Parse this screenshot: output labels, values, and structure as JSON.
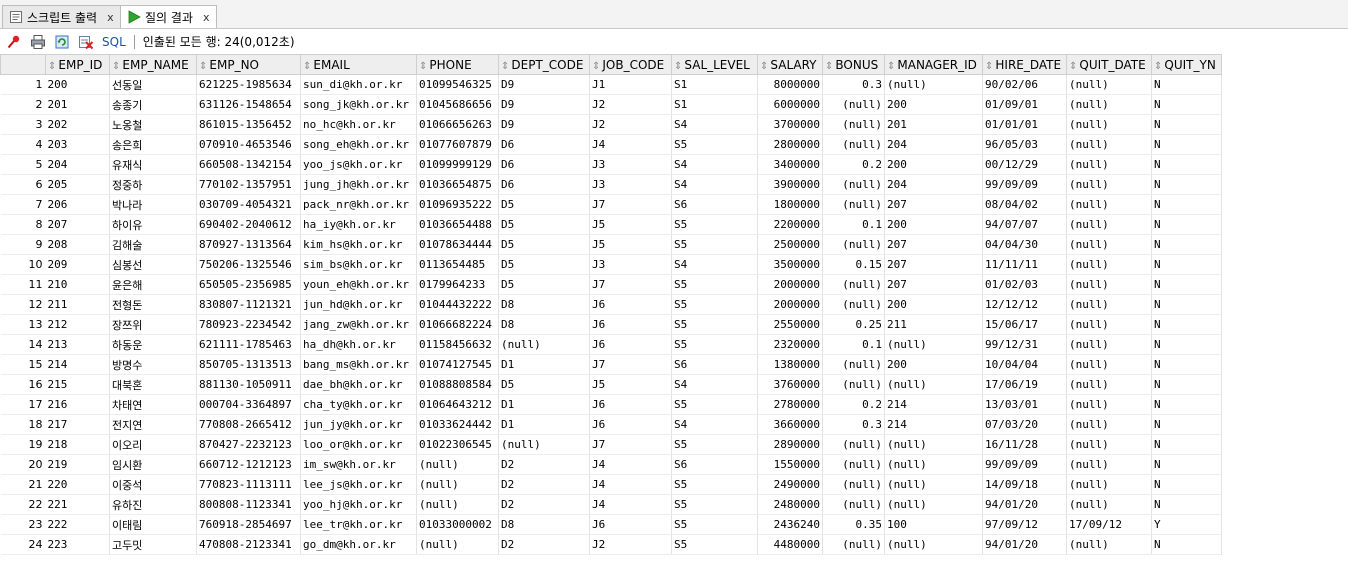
{
  "tabs": [
    {
      "label": "스크립트 출력",
      "close": "x",
      "icon": "script-output-icon"
    },
    {
      "label": "질의 결과",
      "close": "x",
      "icon": "run-icon"
    }
  ],
  "toolbar": {
    "sql_label": "SQL",
    "status": "인출된 모든 행: 24(0,012초)"
  },
  "columns": [
    "EMP_ID",
    "EMP_NAME",
    "EMP_NO",
    "EMAIL",
    "PHONE",
    "DEPT_CODE",
    "JOB_CODE",
    "SAL_LEVEL",
    "SALARY",
    "BONUS",
    "MANAGER_ID",
    "HIRE_DATE",
    "QUIT_DATE",
    "QUIT_YN"
  ],
  "rows": [
    [
      "1",
      "200",
      "선동일",
      "621225-1985634",
      "sun_di@kh.or.kr",
      "01099546325",
      "D9",
      "J1",
      "S1",
      "8000000",
      "0.3",
      "(null)",
      "90/02/06",
      "(null)",
      "N"
    ],
    [
      "2",
      "201",
      "송종기",
      "631126-1548654",
      "song_jk@kh.or.kr",
      "01045686656",
      "D9",
      "J2",
      "S1",
      "6000000",
      "(null)",
      "200",
      "01/09/01",
      "(null)",
      "N"
    ],
    [
      "3",
      "202",
      "노옹철",
      "861015-1356452",
      "no_hc@kh.or.kr",
      "01066656263",
      "D9",
      "J2",
      "S4",
      "3700000",
      "(null)",
      "201",
      "01/01/01",
      "(null)",
      "N"
    ],
    [
      "4",
      "203",
      "송은희",
      "070910-4653546",
      "song_eh@kh.or.kr",
      "01077607879",
      "D6",
      "J4",
      "S5",
      "2800000",
      "(null)",
      "204",
      "96/05/03",
      "(null)",
      "N"
    ],
    [
      "5",
      "204",
      "유재식",
      "660508-1342154",
      "yoo_js@kh.or.kr",
      "01099999129",
      "D6",
      "J3",
      "S4",
      "3400000",
      "0.2",
      "200",
      "00/12/29",
      "(null)",
      "N"
    ],
    [
      "6",
      "205",
      "정중하",
      "770102-1357951",
      "jung_jh@kh.or.kr",
      "01036654875",
      "D6",
      "J3",
      "S4",
      "3900000",
      "(null)",
      "204",
      "99/09/09",
      "(null)",
      "N"
    ],
    [
      "7",
      "206",
      "박나라",
      "030709-4054321",
      "pack_nr@kh.or.kr",
      "01096935222",
      "D5",
      "J7",
      "S6",
      "1800000",
      "(null)",
      "207",
      "08/04/02",
      "(null)",
      "N"
    ],
    [
      "8",
      "207",
      "하이유",
      "690402-2040612",
      "ha_iy@kh.or.kr",
      "01036654488",
      "D5",
      "J5",
      "S5",
      "2200000",
      "0.1",
      "200",
      "94/07/07",
      "(null)",
      "N"
    ],
    [
      "9",
      "208",
      "김해술",
      "870927-1313564",
      "kim_hs@kh.or.kr",
      "01078634444",
      "D5",
      "J5",
      "S5",
      "2500000",
      "(null)",
      "207",
      "04/04/30",
      "(null)",
      "N"
    ],
    [
      "10",
      "209",
      "심봉선",
      "750206-1325546",
      "sim_bs@kh.or.kr",
      "0113654485",
      "D5",
      "J3",
      "S4",
      "3500000",
      "0.15",
      "207",
      "11/11/11",
      "(null)",
      "N"
    ],
    [
      "11",
      "210",
      "윤은해",
      "650505-2356985",
      "youn_eh@kh.or.kr",
      "0179964233",
      "D5",
      "J7",
      "S5",
      "2000000",
      "(null)",
      "207",
      "01/02/03",
      "(null)",
      "N"
    ],
    [
      "12",
      "211",
      "전형돈",
      "830807-1121321",
      "jun_hd@kh.or.kr",
      "01044432222",
      "D8",
      "J6",
      "S5",
      "2000000",
      "(null)",
      "200",
      "12/12/12",
      "(null)",
      "N"
    ],
    [
      "13",
      "212",
      "장쯔위",
      "780923-2234542",
      "jang_zw@kh.or.kr",
      "01066682224",
      "D8",
      "J6",
      "S5",
      "2550000",
      "0.25",
      "211",
      "15/06/17",
      "(null)",
      "N"
    ],
    [
      "14",
      "213",
      "하동운",
      "621111-1785463",
      "ha_dh@kh.or.kr",
      "01158456632",
      "(null)",
      "J6",
      "S5",
      "2320000",
      "0.1",
      "(null)",
      "99/12/31",
      "(null)",
      "N"
    ],
    [
      "15",
      "214",
      "방명수",
      "850705-1313513",
      "bang_ms@kh.or.kr",
      "01074127545",
      "D1",
      "J7",
      "S6",
      "1380000",
      "(null)",
      "200",
      "10/04/04",
      "(null)",
      "N"
    ],
    [
      "16",
      "215",
      "대북혼",
      "881130-1050911",
      "dae_bh@kh.or.kr",
      "01088808584",
      "D5",
      "J5",
      "S4",
      "3760000",
      "(null)",
      "(null)",
      "17/06/19",
      "(null)",
      "N"
    ],
    [
      "17",
      "216",
      "차태연",
      "000704-3364897",
      "cha_ty@kh.or.kr",
      "01064643212",
      "D1",
      "J6",
      "S5",
      "2780000",
      "0.2",
      "214",
      "13/03/01",
      "(null)",
      "N"
    ],
    [
      "18",
      "217",
      "전지연",
      "770808-2665412",
      "jun_jy@kh.or.kr",
      "01033624442",
      "D1",
      "J6",
      "S4",
      "3660000",
      "0.3",
      "214",
      "07/03/20",
      "(null)",
      "N"
    ],
    [
      "19",
      "218",
      "이오리",
      "870427-2232123",
      "loo_or@kh.or.kr",
      "01022306545",
      "(null)",
      "J7",
      "S5",
      "2890000",
      "(null)",
      "(null)",
      "16/11/28",
      "(null)",
      "N"
    ],
    [
      "20",
      "219",
      "임시환",
      "660712-1212123",
      "im_sw@kh.or.kr",
      "(null)",
      "D2",
      "J4",
      "S6",
      "1550000",
      "(null)",
      "(null)",
      "99/09/09",
      "(null)",
      "N"
    ],
    [
      "21",
      "220",
      "이중석",
      "770823-1113111",
      "lee_js@kh.or.kr",
      "(null)",
      "D2",
      "J4",
      "S5",
      "2490000",
      "(null)",
      "(null)",
      "14/09/18",
      "(null)",
      "N"
    ],
    [
      "22",
      "221",
      "유하진",
      "800808-1123341",
      "yoo_hj@kh.or.kr",
      "(null)",
      "D2",
      "J4",
      "S5",
      "2480000",
      "(null)",
      "(null)",
      "94/01/20",
      "(null)",
      "N"
    ],
    [
      "23",
      "222",
      "이태림",
      "760918-2854697",
      "lee_tr@kh.or.kr",
      "01033000002",
      "D8",
      "J6",
      "S5",
      "2436240",
      "0.35",
      "100",
      "97/09/12",
      "17/09/12",
      "Y"
    ],
    [
      "24",
      "223",
      "고두밋",
      "470808-2123341",
      "go_dm@kh.or.kr",
      "(null)",
      "D2",
      "J2",
      "S5",
      "4480000",
      "(null)",
      "(null)",
      "94/01/20",
      "(null)",
      "N"
    ]
  ]
}
